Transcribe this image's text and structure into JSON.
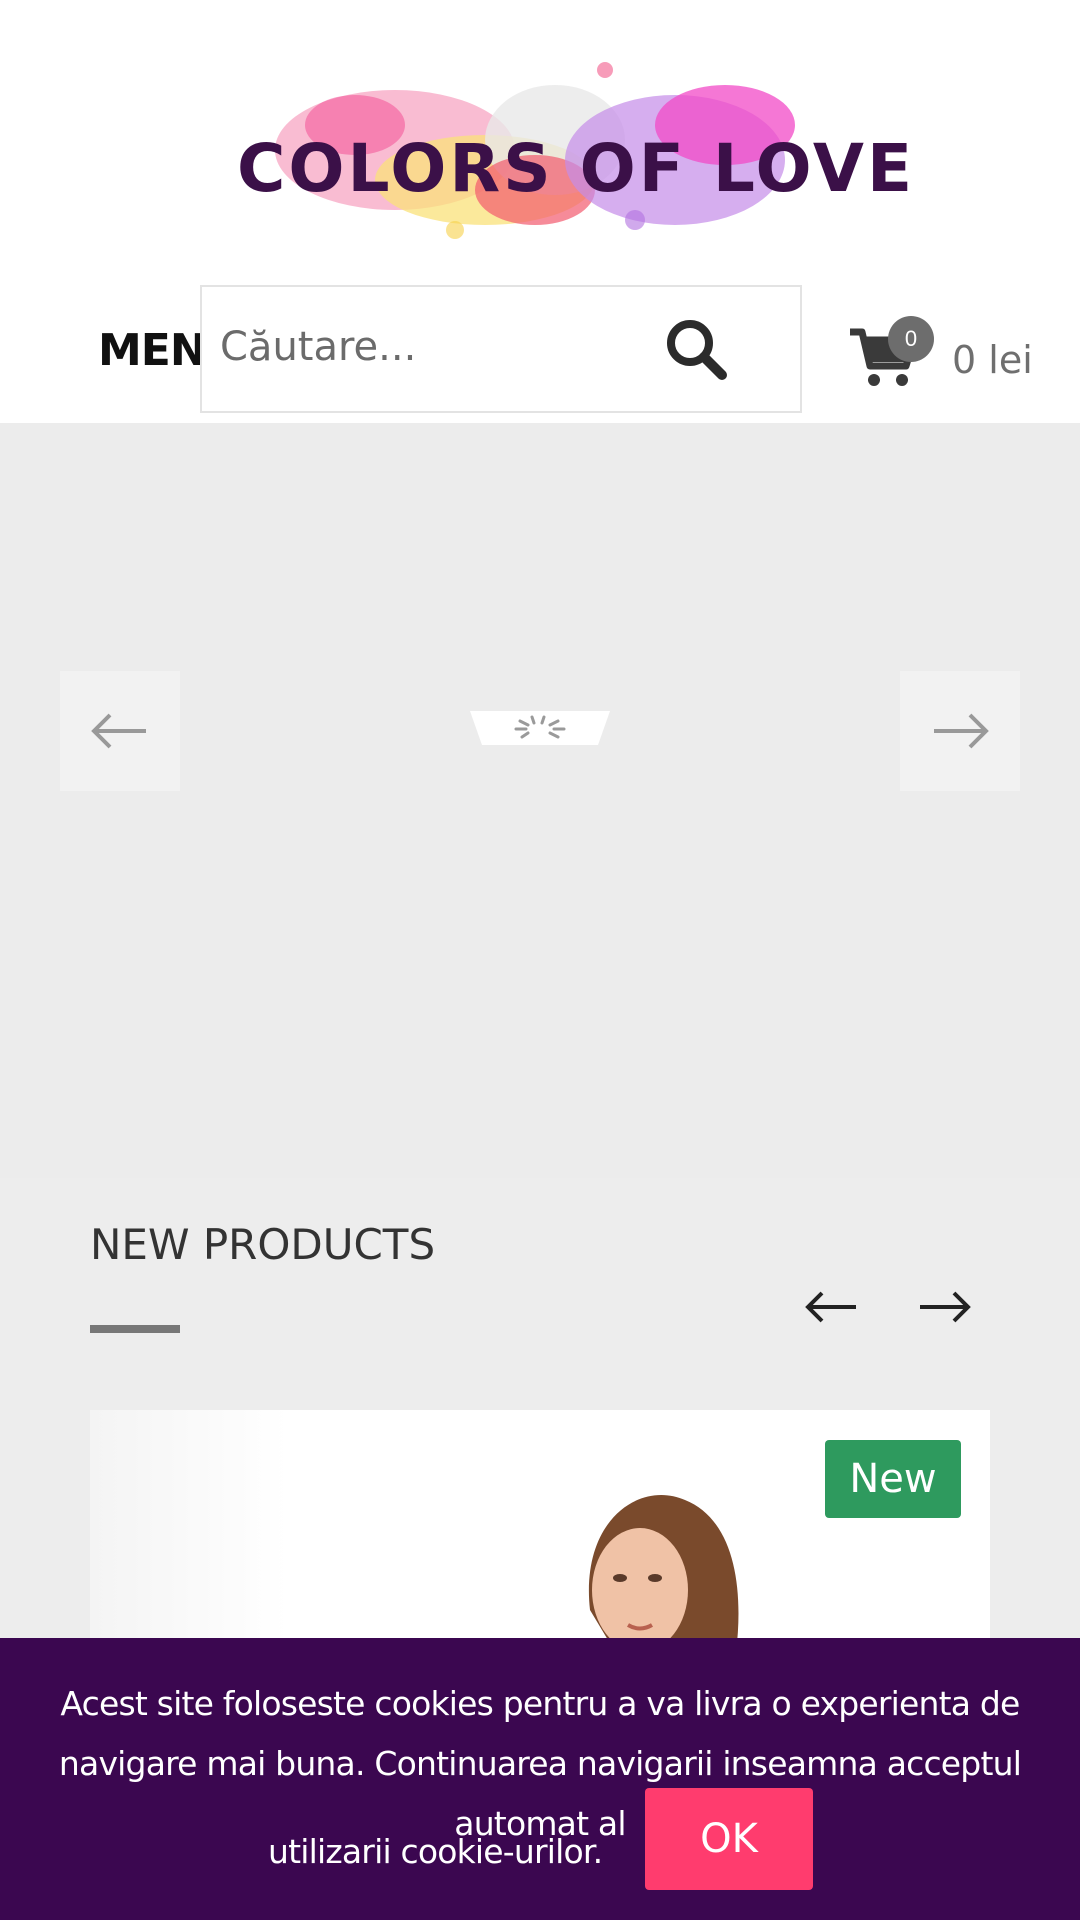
{
  "header": {
    "logo_text": "COLORS OF LOVE",
    "menu_label": "MENU",
    "search_placeholder": "Căutare...",
    "cart_count": "0",
    "cart_total": "0 lei"
  },
  "slider": {
    "prev_icon": "arrow-left-icon",
    "next_icon": "arrow-right-icon",
    "loading": true
  },
  "new_products": {
    "title": "NEW PRODUCTS",
    "prev_icon": "arrow-left-icon",
    "next_icon": "arrow-right-icon",
    "items": [
      {
        "badge": "New"
      }
    ]
  },
  "cookie_bar": {
    "message": "Acest site foloseste cookies pentru a va livra o experienta de navigare mai buna. Continuarea navigarii inseamna acceptul automat al",
    "message_end": "utilizarii cookie-urilor.",
    "ok_label": "OK"
  },
  "colors": {
    "cookie_bg": "#3b0750",
    "ok_button": "#ff3c6e",
    "new_badge": "#2e9a5e",
    "logo_text": "#3b1048"
  }
}
